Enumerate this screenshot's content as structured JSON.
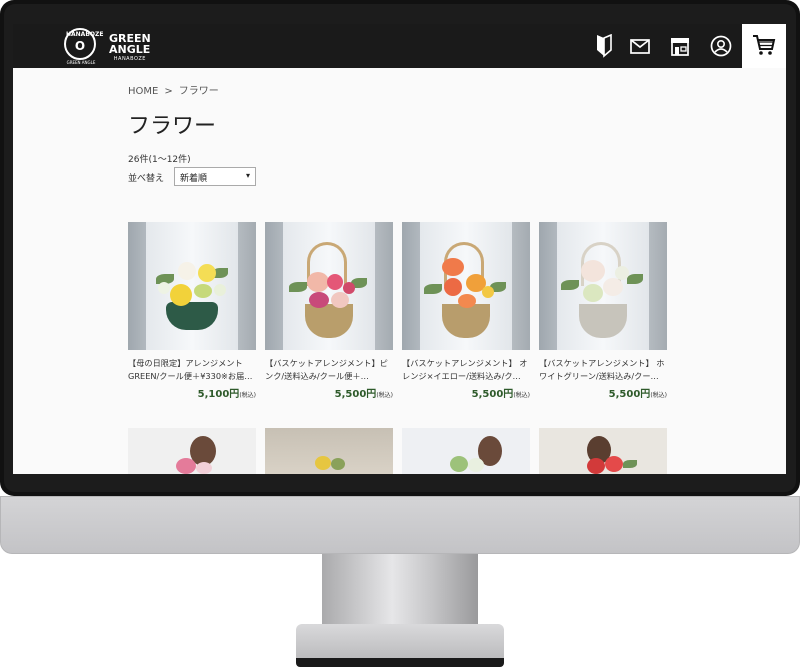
{
  "header": {
    "seal_text": "HANABOZE",
    "seal_caption": "GREEN ANGLE",
    "brand_line1": "GREEN",
    "brand_line2": "ANGLE",
    "brand_line3": "HANABOZE",
    "icons": [
      "beginner-icon",
      "mail-icon",
      "shop-icon",
      "account-icon",
      "cart-icon"
    ]
  },
  "breadcrumb": {
    "home": "HOME",
    "separator": ">",
    "current": "フラワー"
  },
  "page_title": "フラワー",
  "result_count": "26件(1〜12件)",
  "sort": {
    "label": "並べ替え",
    "selected": "新着順"
  },
  "products": [
    {
      "name_line1": "【母の日限定】アレンジメント",
      "name_line2": "GREEN/クール便＋¥330※お届…",
      "price": "5,100円",
      "tax": "(税込)"
    },
    {
      "name_line1": "【バスケットアレンジメント】ピ",
      "name_line2": "ンク/送料込み/クール便＋…",
      "price": "5,500円",
      "tax": "(税込)"
    },
    {
      "name_line1": "【バスケットアレンジメント】 オ",
      "name_line2": "レンジ×イエロー/送料込み/ク…",
      "price": "5,500円",
      "tax": "(税込)"
    },
    {
      "name_line1": "【バスケットアレンジメント】 ホ",
      "name_line2": "ワイトグリーン/送料込み/クー…",
      "price": "5,500円",
      "tax": "(税込)"
    }
  ],
  "colors": {
    "header_bg": "#1a1a1a",
    "price": "#2e5a2a",
    "page_bg": "#fafafa"
  }
}
